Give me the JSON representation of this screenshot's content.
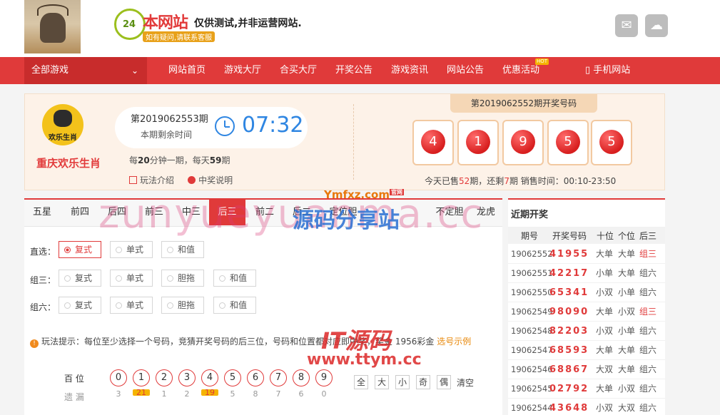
{
  "header": {
    "logo_main": "本网站",
    "logo_sub": "仅供测试,并非运营网站.",
    "logo_tag": "如有疑问,请联系客服",
    "logo_badge": "24",
    "social_icons": [
      "qq-icon",
      "wechat-icon"
    ]
  },
  "nav": {
    "all_games": "全部游戏",
    "items": [
      "网站首页",
      "游戏大厅",
      "合买大厅",
      "开奖公告",
      "游戏资讯",
      "网站公告",
      "优惠活动",
      "手机网站"
    ],
    "hot_badge": "HOT"
  },
  "game": {
    "icon_text": "欢乐生肖",
    "name": "重庆欢乐生肖",
    "current_period": "第2019062553期",
    "remaining_label": "本期剩余时间",
    "timer": "07:32",
    "freq_prefix": "每",
    "freq_minutes": "20",
    "freq_mid": "分钟一期，每天",
    "freq_count": "59",
    "freq_suffix": "期",
    "link_rules": "玩法介绍",
    "link_prize": "中奖说明",
    "draw_title": "第2019062552期开奖号码",
    "draw_numbers": [
      "4",
      "1",
      "9",
      "5",
      "5"
    ],
    "sold_prefix": "今天已售",
    "sold_count": "52",
    "sold_mid": "期，还剩",
    "remaining_count": "7",
    "sold_suffix": "期  销售时间：00:10-23:50"
  },
  "play": {
    "tabs": [
      "五星",
      "前四",
      "后四",
      "前三",
      "中三",
      "后三",
      "前二",
      "后二",
      "定位胆",
      "不定胆",
      "龙虎"
    ],
    "active_tab": "后三",
    "rows": [
      {
        "label": "直选：",
        "options": [
          "复式",
          "单式",
          "和值"
        ]
      },
      {
        "label": "组三：",
        "options": [
          "复式",
          "单式",
          "胆拖",
          "和值"
        ]
      },
      {
        "label": "组六：",
        "options": [
          "复式",
          "单式",
          "胆拖",
          "和值"
        ]
      }
    ],
    "selected": "复式",
    "tip_text": "玩法提示：每位至少选择一个号码，竞猜开奖号码的后三位，号码和位置都对应即中奖，奖金 1956彩金",
    "tip_example": "选号示例",
    "position_label": "百 位",
    "miss_label": "遗 漏",
    "digits": [
      "0",
      "1",
      "2",
      "3",
      "4",
      "5",
      "6",
      "7",
      "8",
      "9"
    ],
    "misses": [
      "3",
      "21",
      "1",
      "2",
      "19",
      "5",
      "8",
      "7",
      "6",
      "0"
    ],
    "quick": [
      "全",
      "大",
      "小",
      "奇",
      "偶"
    ],
    "clear": "清空"
  },
  "recent": {
    "title": "近期开奖",
    "headers": [
      "期号",
      "开奖号码",
      "十位",
      "个位",
      "后三"
    ],
    "rows": [
      {
        "period": "19062552",
        "nums": "41955",
        "a": "大单",
        "b": "大单",
        "c": "组三"
      },
      {
        "period": "19062551",
        "nums": "42217",
        "a": "小单",
        "b": "大单",
        "c": "组六"
      },
      {
        "period": "19062550",
        "nums": "65341",
        "a": "小双",
        "b": "小单",
        "c": "组六"
      },
      {
        "period": "19062549",
        "nums": "98090",
        "a": "大单",
        "b": "小双",
        "c": "组三"
      },
      {
        "period": "19062548",
        "nums": "82203",
        "a": "小双",
        "b": "小单",
        "c": "组六"
      },
      {
        "period": "19062547",
        "nums": "68593",
        "a": "大单",
        "b": "大单",
        "c": "组六"
      },
      {
        "period": "19062546",
        "nums": "68867",
        "a": "大双",
        "b": "大单",
        "c": "组六"
      },
      {
        "period": "19062545",
        "nums": "02792",
        "a": "大单",
        "b": "小双",
        "c": "组六"
      },
      {
        "period": "19062544",
        "nums": "43648",
        "a": "小双",
        "b": "大双",
        "c": "组六"
      }
    ]
  },
  "watermarks": {
    "big": "zunyueyuanma.cc",
    "ymfxz": "Ymfxz.com",
    "ymfxz_tag": "官网",
    "brand": "源码分享站",
    "it": "IT源码",
    "url": "www.ttym.cc"
  },
  "colors": {
    "accent": "#e03a3a",
    "timer": "#2f86e2",
    "hint": "#e8890c"
  }
}
